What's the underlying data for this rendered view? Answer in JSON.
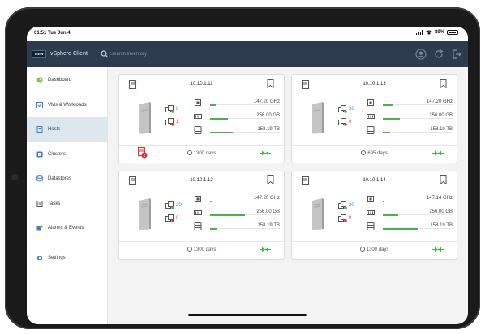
{
  "status_bar": {
    "time_date": "01:51 Tue Jun 4",
    "battery": "89%"
  },
  "header": {
    "logo": "vmw",
    "app_title": "vSphere Client",
    "search": {
      "placeholder": "Search inventory",
      "value": ""
    },
    "icons": [
      "user-icon",
      "refresh-icon",
      "logout-icon"
    ]
  },
  "sidebar": {
    "items": [
      {
        "label": "Dashboard",
        "icon": "dashboard-icon",
        "active": false
      },
      {
        "label": "VMs & Workloads",
        "icon": "vm-icon",
        "active": false
      },
      {
        "label": "Hosts",
        "icon": "host-icon",
        "active": true
      },
      {
        "label": "Clusters",
        "icon": "cluster-icon",
        "active": false
      },
      {
        "label": "Datastores",
        "icon": "datastore-icon",
        "active": false
      },
      {
        "label": "Tasks",
        "icon": "tasks-icon",
        "active": false
      },
      {
        "label": "Alarms & Events",
        "icon": "alarm-icon",
        "active": false
      },
      {
        "label": "Settings",
        "icon": "settings-icon",
        "active": false
      }
    ]
  },
  "hosts": [
    {
      "ip": "10.10.1.11",
      "vms_running": "8",
      "vms_alert": "1",
      "cpu": "147.20 GHz",
      "memory": "256.00 GB",
      "storage": "158.19 TB",
      "cpu_fill": 0.08,
      "memory_fill": 0.25,
      "storage_fill": 0.32,
      "uptime": "1300 days",
      "has_alarm": true,
      "alarm_count": "1"
    },
    {
      "ip": "10.10.1.13",
      "vms_running": "36",
      "vms_alert": "0",
      "cpu": "147.20 GHz",
      "memory": "256.00 GB",
      "storage": "158.19 TB",
      "cpu_fill": 0.14,
      "memory_fill": 0.24,
      "storage_fill": 0.1,
      "uptime": "695 days",
      "has_alarm": false,
      "alarm_count": ""
    },
    {
      "ip": "10.10.1.12",
      "vms_running": "20",
      "vms_alert": "0",
      "cpu": "147.20 GHz",
      "memory": "256.00 GB",
      "storage": "158.19 TB",
      "cpu_fill": 0.02,
      "memory_fill": 0.5,
      "storage_fill": 0.1,
      "uptime": "1300 days",
      "has_alarm": false,
      "alarm_count": ""
    },
    {
      "ip": "10.10.1.14",
      "vms_running": "20",
      "vms_alert": "0",
      "cpu": "147.14 GHz",
      "memory": "256.00 GB",
      "storage": "158.19 TB",
      "cpu_fill": 0.02,
      "memory_fill": 0.22,
      "storage_fill": 0.5,
      "uptime": "1300 days",
      "has_alarm": false,
      "alarm_count": ""
    }
  ],
  "colors": {
    "header": "#2d3b4e",
    "accent_blue": "#3b8fd6",
    "ok_green": "#4caf50",
    "alert_red": "#d33333",
    "active_nav": "#dfe7ee"
  }
}
